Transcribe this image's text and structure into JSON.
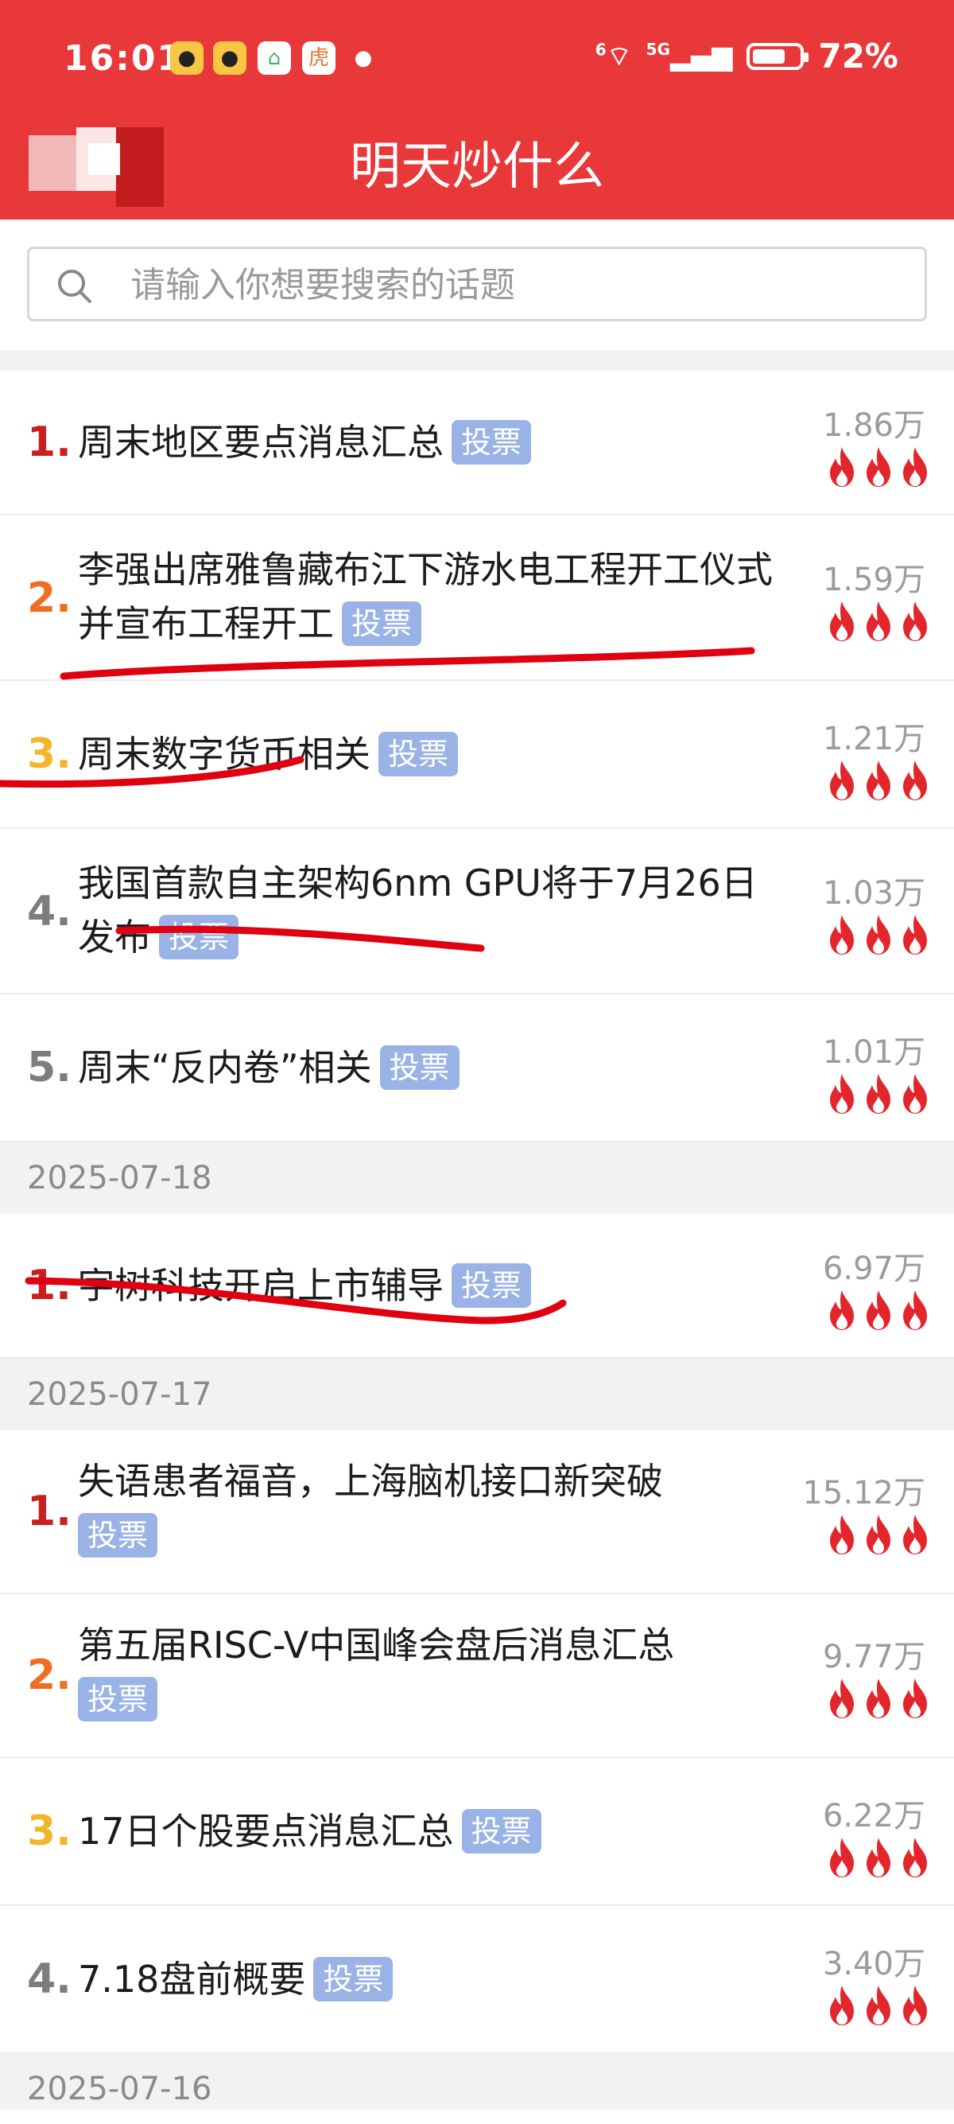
{
  "status_bar": {
    "time": "16:01",
    "network": "5G",
    "wifi_label": "6",
    "battery": "72%",
    "battery_level": 0.72,
    "notification_icons": [
      "weibo-icon",
      "weibo-icon",
      "home-app-icon",
      "tiger-app-icon",
      "chat-bubble-icon"
    ]
  },
  "header": {
    "title": "明天炒什么"
  },
  "search": {
    "placeholder": "请输入你想要搜索的话题"
  },
  "vote_label": "投票",
  "colors": {
    "header_bg": "#e9383a",
    "rank_1": "#c9201f",
    "rank_2": "#ef6e21",
    "rank_3": "#f3b62a",
    "rank_other": "#7d7d7d",
    "vote_badge": "#9ab3e6",
    "flame": "#e2262b",
    "annotation": "#e00010"
  },
  "sections": [
    {
      "date": "",
      "items": [
        {
          "rank": "1.",
          "title": "周末地区要点消息汇总",
          "count": "1.86万"
        },
        {
          "rank": "2.",
          "title": "李强出席雅鲁藏布江下游水电工程开工仪式 并宣布工程开工",
          "count": "1.59万"
        },
        {
          "rank": "3.",
          "title": "周末数字货币相关",
          "count": "1.21万"
        },
        {
          "rank": "4.",
          "title": "我国首款自主架构6nm GPU将于7月26日发布",
          "count": "1.03万"
        },
        {
          "rank": "5.",
          "title": "周末“反内卷”相关",
          "count": "1.01万"
        }
      ]
    },
    {
      "date": "2025-07-18",
      "items": [
        {
          "rank": "1.",
          "title": "宇树科技开启上市辅导",
          "count": "6.97万"
        }
      ]
    },
    {
      "date": "2025-07-17",
      "items": [
        {
          "rank": "1.",
          "title": "失语患者福音，上海脑机接口新突破",
          "count": "15.12万"
        },
        {
          "rank": "2.",
          "title": "第五届RISC-V中国峰会盘后消息汇总",
          "count": "9.77万"
        },
        {
          "rank": "3.",
          "title": "17日个股要点消息汇总",
          "count": "6.22万"
        },
        {
          "rank": "4.",
          "title": "7.18盘前概要",
          "count": "3.40万"
        }
      ]
    },
    {
      "date": "2025-07-16",
      "items": []
    }
  ]
}
